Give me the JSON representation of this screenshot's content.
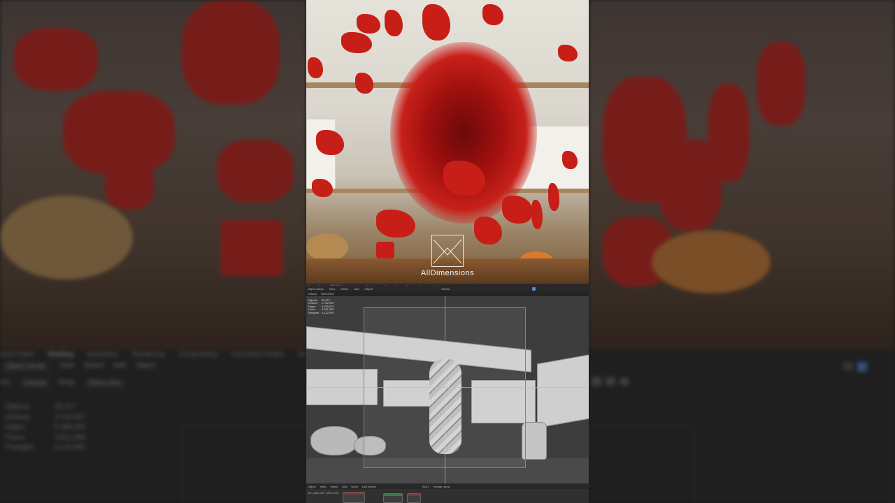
{
  "background": {
    "tabs": [
      "xture Paint",
      "Shading",
      "Animation",
      "Rendering",
      "Compositing",
      "Geometry Nodes",
      "Scri"
    ],
    "active_tab": "Shading",
    "toolbar": {
      "mode": "Object Mode",
      "menus": [
        "View",
        "Select",
        "Add",
        "Object"
      ]
    },
    "toolbar2": {
      "orientation_label": "ion:",
      "orientation_value": "Default",
      "drag_label": "Drag:",
      "drag_value": "Select Box"
    },
    "stats": [
      {
        "label": "Objects",
        "value": "20,417"
      },
      {
        "label": "Vertices",
        "value": "2,702,067"
      },
      {
        "label": "Edges",
        "value": "6,485,091"
      },
      {
        "label": "Faces",
        "value": "3,811,998"
      },
      {
        "label": "Triangles",
        "value": "4,132,991"
      }
    ]
  },
  "render": {
    "watermark": "AllDimensions",
    "colors": {
      "tomato": "#c81e18",
      "counter": "#7a5a38",
      "wall": "#e5e2da"
    }
  },
  "blender": {
    "workspace_tabs": [
      "Texture Paint",
      "Shading",
      "Animation",
      "Rendering",
      "Compositing",
      "Geometry Nodes",
      "Scripting"
    ],
    "active_tab": "Shading",
    "mode": "Object Mode",
    "menus": [
      "View",
      "Select",
      "Add",
      "Object"
    ],
    "orientation": "Default",
    "drag": "Select Box",
    "transform": "Global",
    "stats": [
      {
        "label": "Objects",
        "value": "20,417"
      },
      {
        "label": "Vertices",
        "value": "2,702,067"
      },
      {
        "label": "Edges",
        "value": "6,485,091"
      },
      {
        "label": "Faces",
        "value": "3,811,998"
      },
      {
        "label": "Triangles",
        "value": "4,132,991"
      }
    ],
    "node_editor": {
      "mode": "Object",
      "menus": [
        "View",
        "Select",
        "Add",
        "Node"
      ],
      "use_nodes": "Use Nodes",
      "slot": "Slot 1",
      "material": "tomato_sima",
      "breadcrumb": "tom_fal3.039 › Mesh.033"
    }
  }
}
